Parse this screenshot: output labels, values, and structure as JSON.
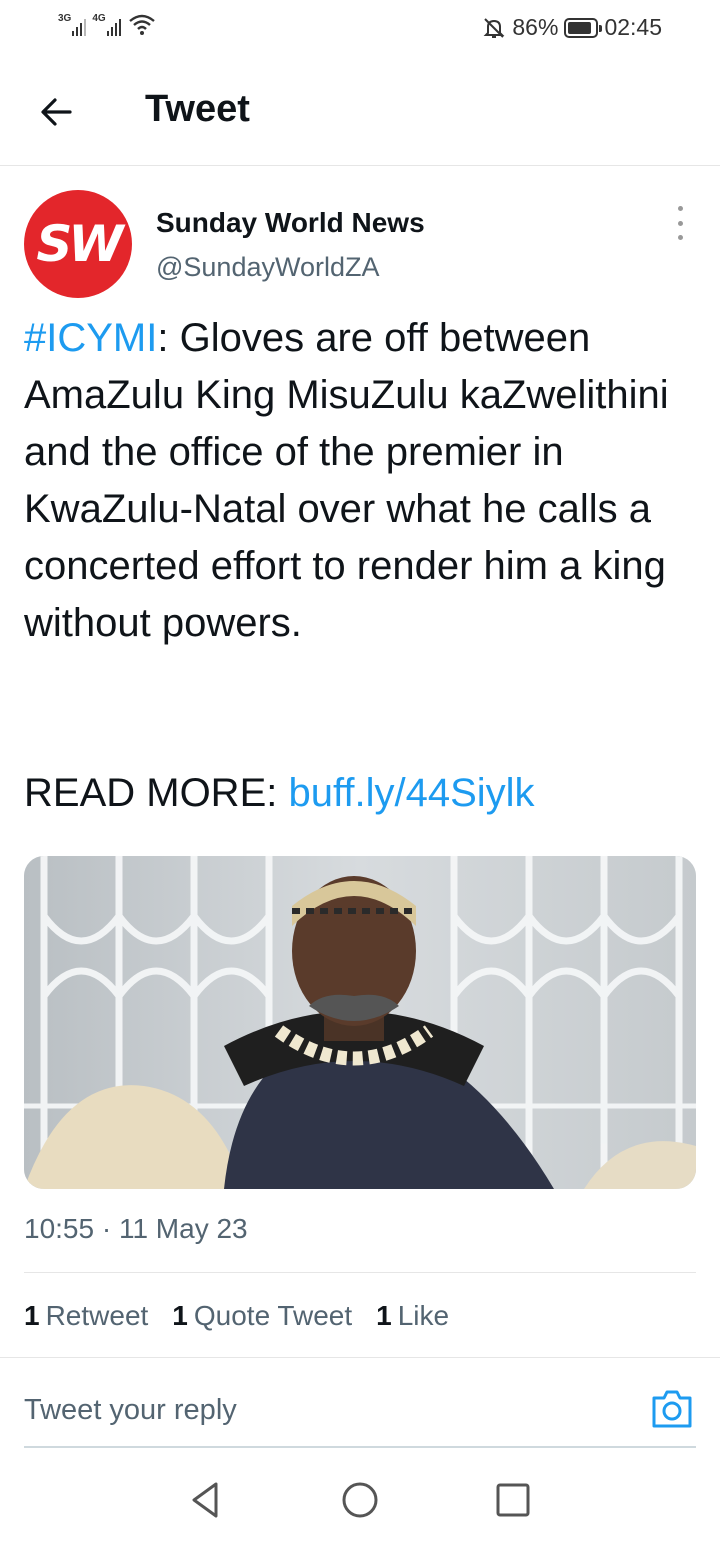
{
  "status_bar": {
    "net1": "3G",
    "net2": "4G",
    "battery": "86%",
    "battery_level": 0.86,
    "time": "02:45"
  },
  "header": {
    "title": "Tweet",
    "back_icon": "arrow-left-icon"
  },
  "tweet": {
    "avatar_text": "SW",
    "author_name": "Sunday World News",
    "author_handle": "@SundayWorldZA",
    "hashtag": "#ICYMI",
    "body": ": Gloves are off between AmaZulu King MisuZulu kaZwelithini and the office of the premier in KwaZulu-Natal over what he calls a concerted effort to render him a king without powers.",
    "read_more_label": "READ MORE: ",
    "link": "buff.ly/44Siylk",
    "timestamp": "10:55 · 11 May 23"
  },
  "stats": {
    "retweets_count": "1",
    "retweets_label": "Retweet",
    "quotes_count": "1",
    "quotes_label": "Quote Tweet",
    "likes_count": "1",
    "likes_label": "Like"
  },
  "reply": {
    "placeholder": "Tweet your reply",
    "camera_icon": "camera-icon"
  },
  "colors": {
    "accent": "#1d9bf0",
    "avatar_bg": "#e3262b",
    "secondary_text": "#536471"
  }
}
